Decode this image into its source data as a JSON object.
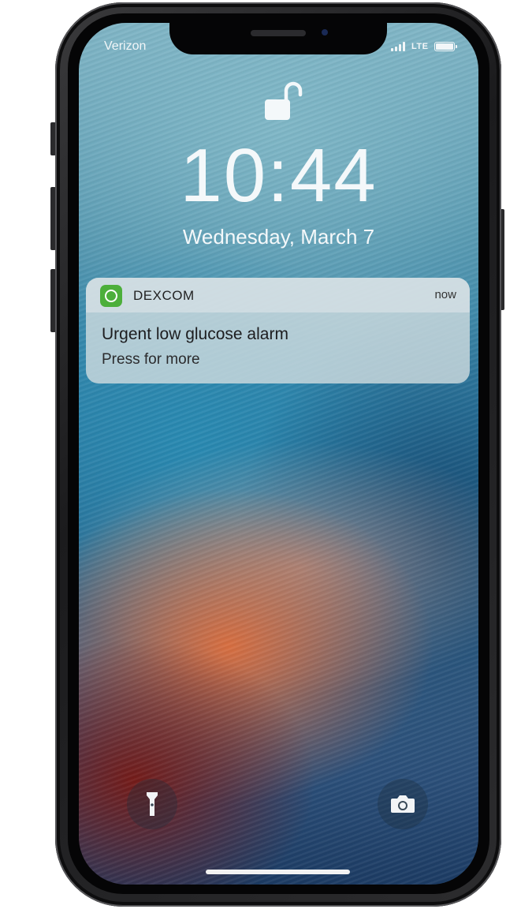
{
  "status_bar": {
    "carrier": "Verizon",
    "network": "LTE",
    "signal_bars": 4,
    "battery_level": 1.0
  },
  "lock_screen": {
    "lock_state": "unlocked",
    "time": "10:44",
    "date": "Wednesday, March 7"
  },
  "notification": {
    "app_name": "DEXCOM",
    "timestamp": "now",
    "title": "Urgent low glucose alarm",
    "body": "Press for more",
    "app_icon": "dexcom-app-icon",
    "app_icon_color": "#4caf3b"
  },
  "quick_actions": {
    "left": "flashlight-icon",
    "right": "camera-icon"
  }
}
